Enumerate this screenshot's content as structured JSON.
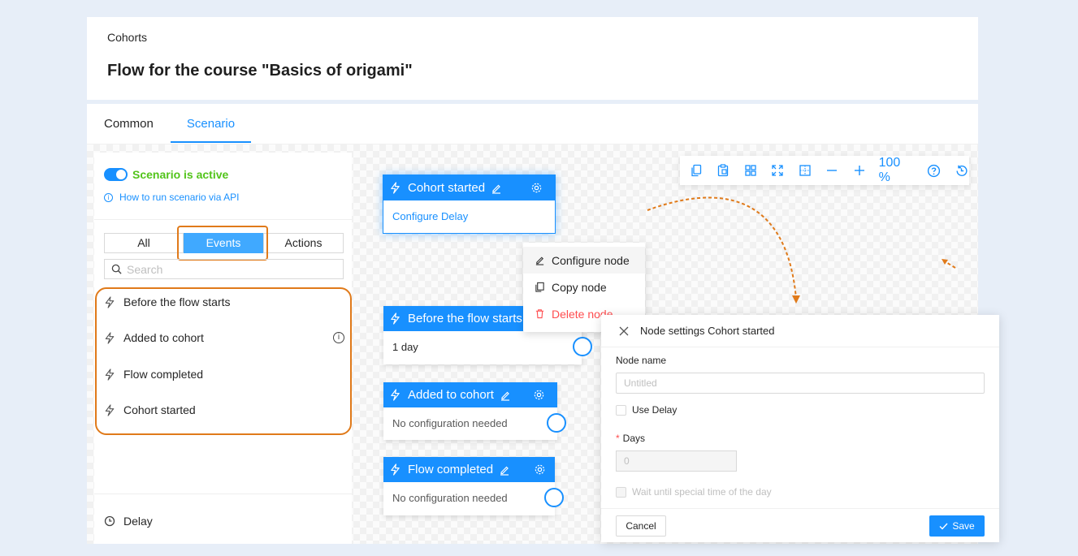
{
  "header": {
    "breadcrumb": "Cohorts",
    "title": "Flow for the course \"Basics of origami\""
  },
  "tabs": [
    {
      "label": "Common"
    },
    {
      "label": "Scenario",
      "active": true
    }
  ],
  "left_panel": {
    "scenario_status": "Scenario is active",
    "api_link": "How to run scenario via API",
    "segments": [
      {
        "label": "All"
      },
      {
        "label": "Events",
        "selected": true
      },
      {
        "label": "Actions"
      }
    ],
    "search_placeholder": "Search",
    "events": [
      {
        "label": "Before the flow starts",
        "icon": "bolt-icon"
      },
      {
        "label": "Added to cohort",
        "icon": "bolt-icon",
        "info": true
      },
      {
        "label": "Flow completed",
        "icon": "bolt-icon"
      },
      {
        "label": "Cohort started",
        "icon": "bolt-icon"
      }
    ],
    "delay_label": "Delay"
  },
  "nodes": [
    {
      "title": "Cohort started",
      "body": "Configure Delay"
    },
    {
      "title": "Before the flow starts",
      "body": "1 day"
    },
    {
      "title": "Added to cohort",
      "body": "No configuration needed"
    },
    {
      "title": "Flow completed",
      "body": "No configuration needed"
    }
  ],
  "context_menu": [
    {
      "label": "Configure node",
      "icon": "edit-icon"
    },
    {
      "label": "Copy node",
      "icon": "copy-icon"
    },
    {
      "label": "Delete node",
      "icon": "trash-icon"
    }
  ],
  "toolbar": {
    "zoom": "100 %",
    "icons": [
      "copy-icon",
      "paste-icon",
      "grid-icon",
      "fit-icon",
      "select-area-icon",
      "zoom-out-icon",
      "zoom-in-icon",
      "help-icon",
      "history-icon"
    ]
  },
  "dialog": {
    "title": "Node settings Cohort started",
    "node_name_label": "Node name",
    "node_name_placeholder": "Untitled",
    "use_delay_label": "Use Delay",
    "days_required_mark": "*",
    "days_label": "Days",
    "days_value": "0",
    "wait_label": "Wait until special time of the day",
    "cancel_label": "Cancel",
    "save_label": "Save"
  },
  "colors": {
    "primary": "#1890ff",
    "success": "#52c41a",
    "danger": "#ff4d4f",
    "highlight": "#e07a1a"
  }
}
